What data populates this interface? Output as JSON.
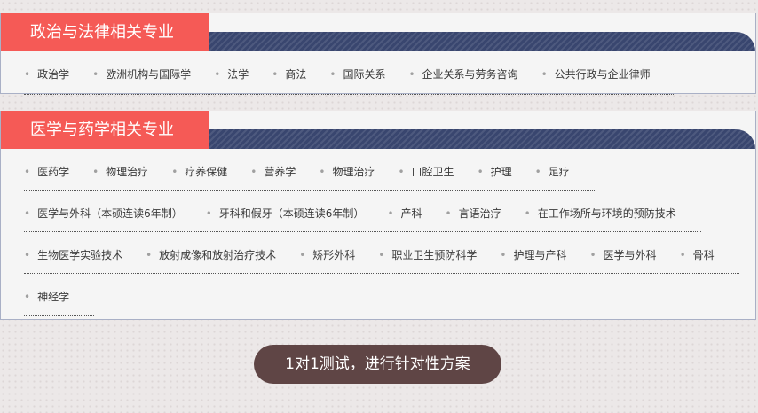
{
  "sections": [
    {
      "title": "政治与法律相关专业",
      "rows": [
        [
          "政治学",
          "欧洲机构与国际学",
          "法学",
          "商法",
          "国际关系",
          "企业关系与劳务咨询",
          "公共行政与企业律师"
        ]
      ]
    },
    {
      "title": "医学与药学相关专业",
      "rows": [
        [
          "医药学",
          "物理治疗",
          "疗养保健",
          "营养学",
          "物理治疗",
          "口腔卫生",
          "护理",
          "足疗"
        ],
        [
          "医学与外科（本硕连读6年制）",
          "牙科和假牙（本硕连读6年制）",
          "产科",
          "言语治疗",
          "在工作场所与环境的预防技术"
        ],
        [
          "生物医学实验技术",
          "放射成像和放射治疗技术",
          "矫形外科",
          "职业卫生预防科学",
          "护理与产科",
          "医学与外科",
          "骨科"
        ],
        [
          "神经学"
        ]
      ]
    }
  ],
  "cta": {
    "label": "1对1测试，进行针对性方案"
  },
  "colors": {
    "tag": "#f55a56",
    "band": "#39466f",
    "cta": "#5f4545",
    "card": "#f5f5f5",
    "page": "#ece8e8"
  }
}
